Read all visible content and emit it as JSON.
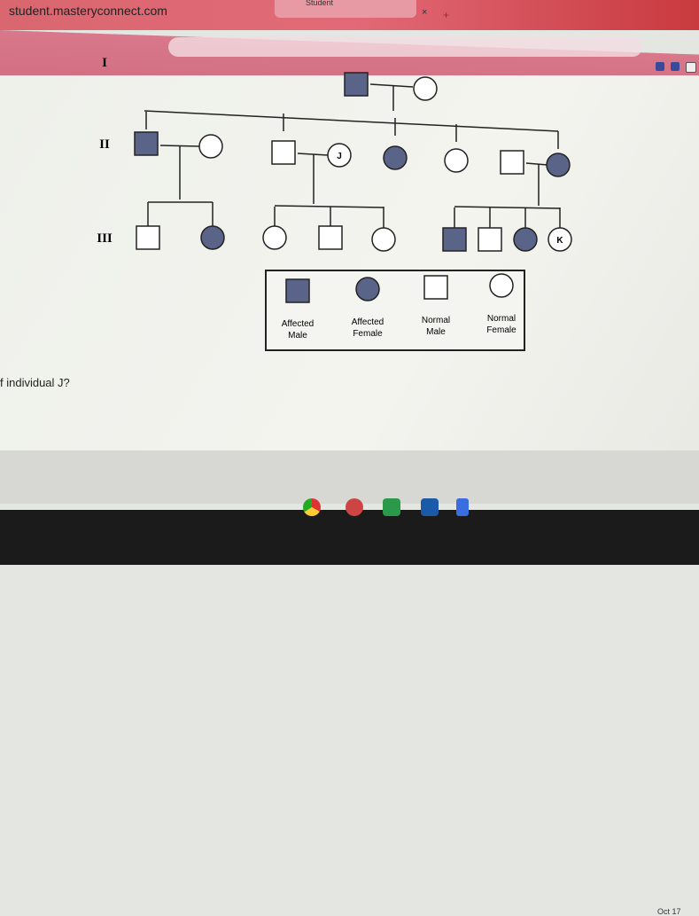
{
  "browser": {
    "url": "student.masteryconnect.com",
    "tab_title": "Student",
    "close_label": "×",
    "new_tab_label": "+"
  },
  "colors": {
    "affected": "#5a6488",
    "normal": "#ffffff",
    "line": "#222222",
    "tabbar": "#d9676f"
  },
  "pedigree": {
    "generation_labels": [
      "I",
      "II",
      "III"
    ],
    "individuals": [
      {
        "id": "I-1",
        "gen": "I",
        "sex": "male",
        "affected": true,
        "label": ""
      },
      {
        "id": "I-2",
        "gen": "I",
        "sex": "female",
        "affected": false,
        "label": ""
      },
      {
        "id": "II-1",
        "gen": "II",
        "sex": "male",
        "affected": true,
        "label": ""
      },
      {
        "id": "II-2",
        "gen": "II",
        "sex": "female",
        "affected": false,
        "label": ""
      },
      {
        "id": "II-3",
        "gen": "II",
        "sex": "male",
        "affected": false,
        "label": ""
      },
      {
        "id": "II-4",
        "gen": "II",
        "sex": "female",
        "affected": false,
        "label": "J"
      },
      {
        "id": "II-5",
        "gen": "II",
        "sex": "female",
        "affected": true,
        "label": ""
      },
      {
        "id": "II-6",
        "gen": "II",
        "sex": "female",
        "affected": false,
        "label": ""
      },
      {
        "id": "II-7",
        "gen": "II",
        "sex": "male",
        "affected": false,
        "label": ""
      },
      {
        "id": "II-8",
        "gen": "II",
        "sex": "female",
        "affected": true,
        "label": ""
      },
      {
        "id": "III-1",
        "gen": "III",
        "sex": "male",
        "affected": false,
        "label": ""
      },
      {
        "id": "III-2",
        "gen": "III",
        "sex": "female",
        "affected": true,
        "label": ""
      },
      {
        "id": "III-3",
        "gen": "III",
        "sex": "female",
        "affected": false,
        "label": ""
      },
      {
        "id": "III-4",
        "gen": "III",
        "sex": "male",
        "affected": false,
        "label": ""
      },
      {
        "id": "III-5",
        "gen": "III",
        "sex": "female",
        "affected": false,
        "label": ""
      },
      {
        "id": "III-6",
        "gen": "III",
        "sex": "male",
        "affected": true,
        "label": ""
      },
      {
        "id": "III-7",
        "gen": "III",
        "sex": "male",
        "affected": false,
        "label": ""
      },
      {
        "id": "III-8",
        "gen": "III",
        "sex": "female",
        "affected": true,
        "label": ""
      },
      {
        "id": "III-9",
        "gen": "III",
        "sex": "female",
        "affected": false,
        "label": "K"
      }
    ]
  },
  "legend": [
    {
      "sex": "male",
      "affected": true,
      "label1": "Affected",
      "label2": "Male"
    },
    {
      "sex": "female",
      "affected": true,
      "label1": "Affected",
      "label2": "Female"
    },
    {
      "sex": "male",
      "affected": false,
      "label1": "Normal",
      "label2": "Male"
    },
    {
      "sex": "female",
      "affected": false,
      "label1": "Normal",
      "label2": "Female"
    }
  ],
  "question": "f individual J?",
  "shelf": {
    "date": "Oct 17",
    "apps": [
      "chrome-icon",
      "app-icon",
      "outlook-icon",
      "files-icon",
      "docs-icon"
    ]
  }
}
